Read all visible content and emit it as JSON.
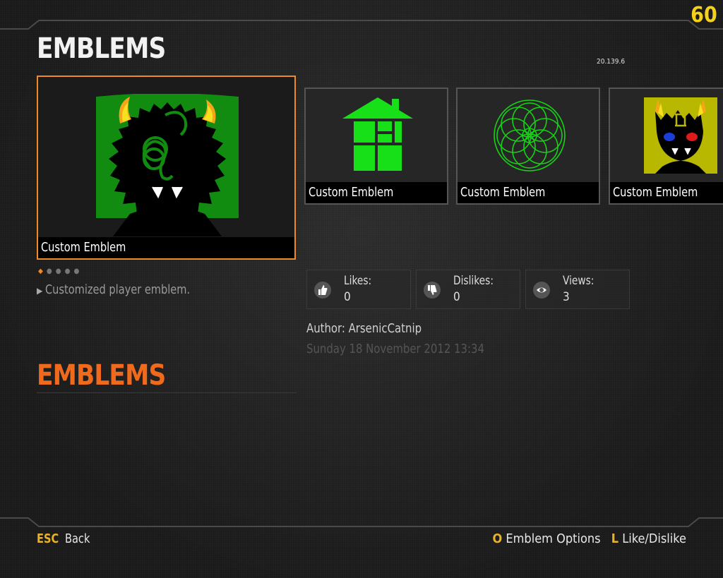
{
  "header": {
    "title": "EMBLEMS",
    "fps": "60",
    "version": "20.139.6"
  },
  "selected_emblem": {
    "caption": "Custom Emblem"
  },
  "emblem_row": [
    {
      "caption": "Custom Emblem",
      "icon": "house-icon"
    },
    {
      "caption": "Custom Emblem",
      "icon": "spirograph-icon"
    },
    {
      "caption": "Custom Emblem",
      "icon": "gemini-troll-icon"
    }
  ],
  "description": "Customized player emblem.",
  "stats": {
    "likes_label": "Likes:",
    "likes": "0",
    "dislikes_label": "Dislikes:",
    "dislikes": "0",
    "views_label": "Views:",
    "views": "3"
  },
  "author": "Author: ArsenicCatnip",
  "date": "Sunday 18 November 2012  13:34",
  "section_title": "EMBLEMS",
  "footer": {
    "back_key": "ESC",
    "back_label": "Back",
    "options_key": "O",
    "options_label": "Emblem Options",
    "like_key": "L",
    "like_label": "Like/Dislike"
  },
  "colors": {
    "accent": "#f08a24",
    "fps": "#f4d21b",
    "section": "#f06a1e",
    "key": "#e9b227"
  }
}
